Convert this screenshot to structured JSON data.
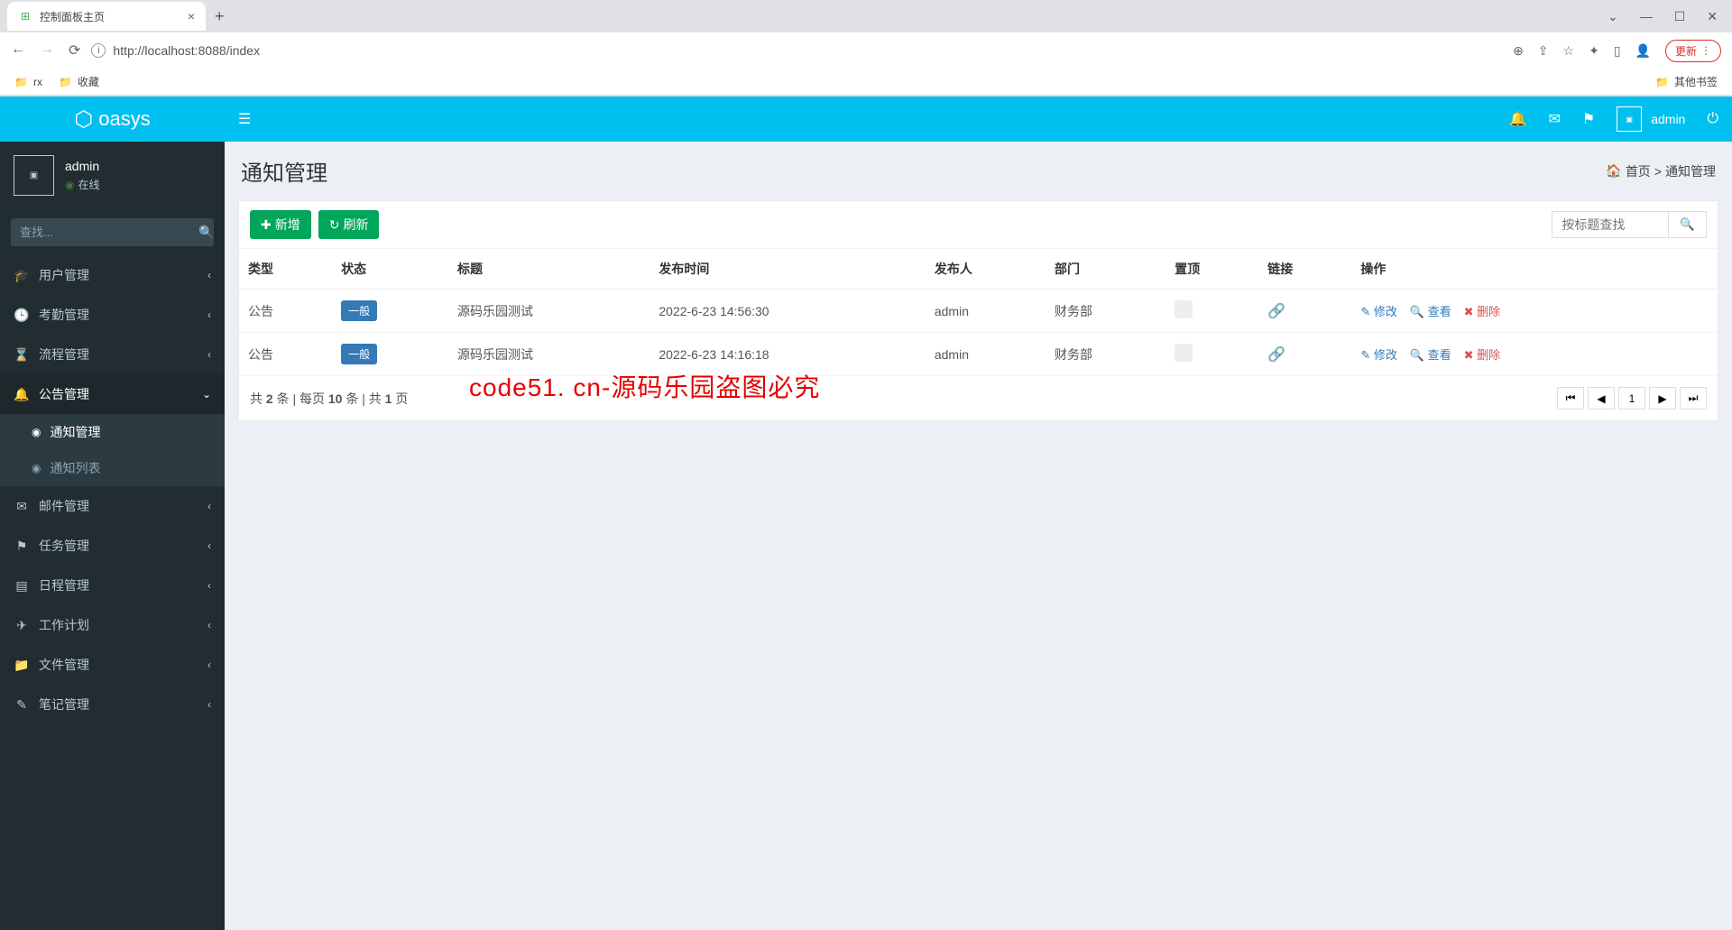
{
  "browser": {
    "tab_title": "控制面板主页",
    "url": "http://localhost:8088/index",
    "update": "更新",
    "bookmarks": [
      "rx",
      "收藏"
    ],
    "other_bookmarks": "其他书签"
  },
  "logo": "oasys",
  "user": {
    "name": "admin",
    "status": "在线"
  },
  "sidebar": {
    "search_placeholder": "查找...",
    "items": [
      {
        "icon": "🎓",
        "label": "用户管理"
      },
      {
        "icon": "🕒",
        "label": "考勤管理"
      },
      {
        "icon": "⌛",
        "label": "流程管理"
      },
      {
        "icon": "🔔",
        "label": "公告管理",
        "open": true,
        "children": [
          {
            "label": "通知管理",
            "active": true
          },
          {
            "label": "通知列表"
          }
        ]
      },
      {
        "icon": "✉",
        "label": "邮件管理"
      },
      {
        "icon": "⚑",
        "label": "任务管理"
      },
      {
        "icon": "▤",
        "label": "日程管理"
      },
      {
        "icon": "✈",
        "label": "工作计划"
      },
      {
        "icon": "📁",
        "label": "文件管理"
      },
      {
        "icon": "✎",
        "label": "笔记管理"
      }
    ]
  },
  "topbar": {
    "user": "admin"
  },
  "page": {
    "title": "通知管理",
    "breadcrumb_home": "首页",
    "breadcrumb_current": "通知管理",
    "add": "新增",
    "refresh": "刷新",
    "search_placeholder": "按标题查找",
    "columns": [
      "类型",
      "状态",
      "标题",
      "发布时间",
      "发布人",
      "部门",
      "置顶",
      "链接",
      "操作"
    ],
    "rows": [
      {
        "type": "公告",
        "status": "一般",
        "title": "源码乐园测试",
        "time": "2022-6-23 14:56:30",
        "publisher": "admin",
        "dept": "财务部"
      },
      {
        "type": "公告",
        "status": "一般",
        "title": "源码乐园测试",
        "time": "2022-6-23 14:16:18",
        "publisher": "admin",
        "dept": "财务部"
      }
    ],
    "actions": {
      "edit": "修改",
      "view": "查看",
      "delete": "删除"
    },
    "footer": {
      "total": "2",
      "per_page": "10",
      "pages": "1",
      "text_prefix": "共 ",
      "text_mid1": " 条 | 每页 ",
      "text_mid2": " 条 | 共 ",
      "text_suffix": " 页"
    },
    "current_page": "1"
  },
  "watermark": "code51. cn-源码乐园盗图必究"
}
